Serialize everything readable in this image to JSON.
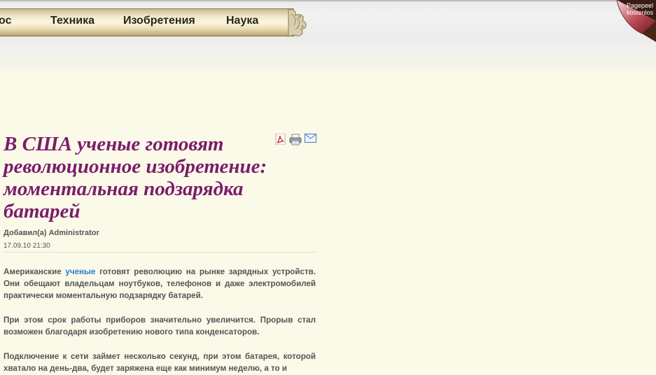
{
  "nav": {
    "items": [
      {
        "label": "ос"
      },
      {
        "label": "Техника"
      },
      {
        "label": "Изобретения"
      },
      {
        "label": "Наука"
      }
    ]
  },
  "peel": {
    "line1": "Pagepeel",
    "line2": "kostenlos"
  },
  "article": {
    "title": "В США ученые готовят революционное изобретение: моментальная подзарядка батарей",
    "author": "Добавил(а) Administrator",
    "date": "17.09.10 21:30",
    "icons": [
      "pdf-icon",
      "print-icon",
      "email-icon"
    ],
    "p1_before": "Американские ",
    "p1_link": "ученые",
    "p1_after": " готовят революцию на рынке зарядных устройств. Они обещают владельцам ноутбуков, телефонов и даже электромобилей практически моментальную подзарядку батарей.",
    "p2": "При этом срок работы приборов значительно увеличится. Прорыв стал возможен благодаря изобретению нового типа конденсаторов.",
    "p3": "Подключение к сети займет несколько секунд, при этом батарея, которой хватало на день-два, будет заряжена еще как минимум неделю, а то и"
  },
  "colors": {
    "background": "#fbf9e8",
    "title": "#7a1c6c",
    "link": "#2b7fc8",
    "body_text": "#555559"
  }
}
